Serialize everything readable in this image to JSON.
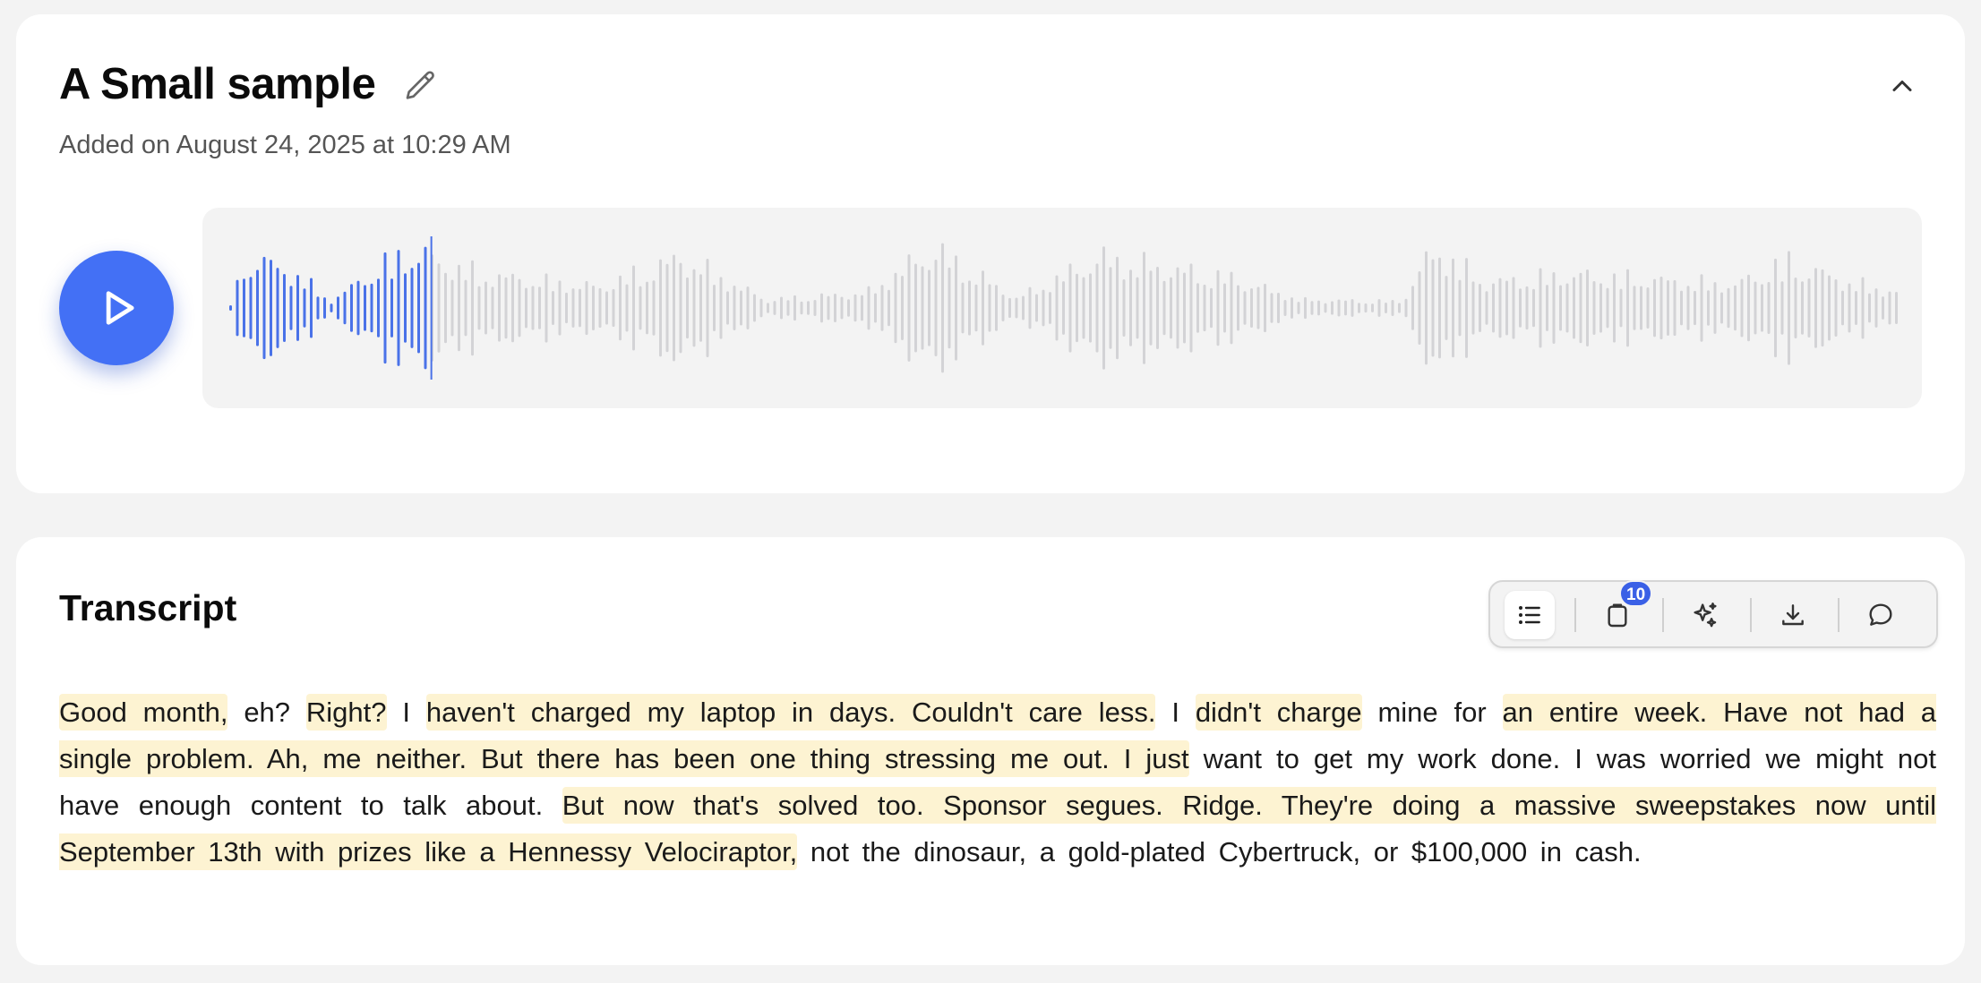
{
  "recording": {
    "title": "A Small sample",
    "added_label": "Added on August 24, 2025 at 10:29 AM",
    "playback_progress": 0.12
  },
  "icons": {
    "edit": "pencil-icon",
    "collapse": "chevron-up-icon",
    "play": "play-icon"
  },
  "colors": {
    "accent": "#4370f5",
    "wave_played": "#4a72e8",
    "wave_unplayed": "#d3d3d6",
    "highlight": "#fdf3d2",
    "badge": "#3a60e6"
  },
  "transcript": {
    "title": "Transcript",
    "toolbar": {
      "list_icon": "list-icon",
      "clipboard_icon": "clipboard-icon",
      "clipboard_badge": "10",
      "ai_icon": "sparkles-icon",
      "download_icon": "download-icon",
      "comment_icon": "comment-icon"
    },
    "segments": [
      {
        "text": "Good month,",
        "highlight": true
      },
      {
        "text": "eh?",
        "highlight": false
      },
      {
        "text": "Right?",
        "highlight": true
      },
      {
        "text": "I",
        "highlight": false
      },
      {
        "text": "haven't charged my laptop in days. Couldn't care less.",
        "highlight": true
      },
      {
        "text": "I",
        "highlight": false
      },
      {
        "text": "didn't charge",
        "highlight": true
      },
      {
        "text": "mine for",
        "highlight": false
      },
      {
        "text": "an entire week. Have not had a single problem. Ah, me neither. But there has been one thing stressing me out. I just",
        "highlight": true
      },
      {
        "text": "want to get my work done. I was worried we might not have enough content to talk about.",
        "highlight": false
      },
      {
        "text": "But now that's solved too. Sponsor segues. Ridge. They're doing a massive sweepstakes now until September 13th with prizes like a Hennessy Velociraptor,",
        "highlight": true
      },
      {
        "text": "not the dinosaur, a gold-plated Cybertruck, or $100,000 in cash.",
        "highlight": false
      }
    ]
  }
}
